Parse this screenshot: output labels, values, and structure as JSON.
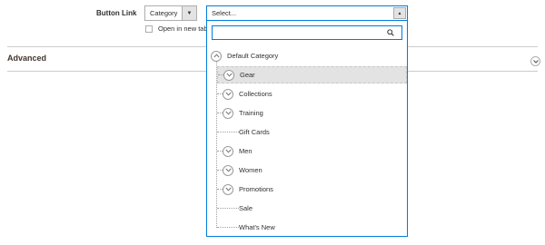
{
  "field": {
    "label": "Button Link",
    "type_select": {
      "value": "Category",
      "arrow_icon": "triangle-down-icon"
    },
    "checkbox_label": "Open in new tab",
    "link_select": {
      "value": "Select...",
      "arrow_icon": "triangle-up-icon"
    }
  },
  "dropdown": {
    "search_value": "",
    "search_icon": "search-icon",
    "root": {
      "label": "Default Category"
    },
    "children": [
      {
        "label": "Gear",
        "has_children": true,
        "selected": true
      },
      {
        "label": "Collections",
        "has_children": true
      },
      {
        "label": "Training",
        "has_children": true
      },
      {
        "label": "Gift Cards",
        "has_children": false
      },
      {
        "label": "Men",
        "has_children": true
      },
      {
        "label": "Women",
        "has_children": true
      },
      {
        "label": "Promotions",
        "has_children": true
      },
      {
        "label": "Sale",
        "has_children": false
      },
      {
        "label": "What's New",
        "has_children": false
      }
    ]
  },
  "section": {
    "title": "Advanced",
    "toggle_icon": "chevron-down-circle-icon"
  },
  "colors": {
    "focus_border": "#007bdb",
    "selected_bg": "#e3e3e3",
    "text": "#303030"
  }
}
